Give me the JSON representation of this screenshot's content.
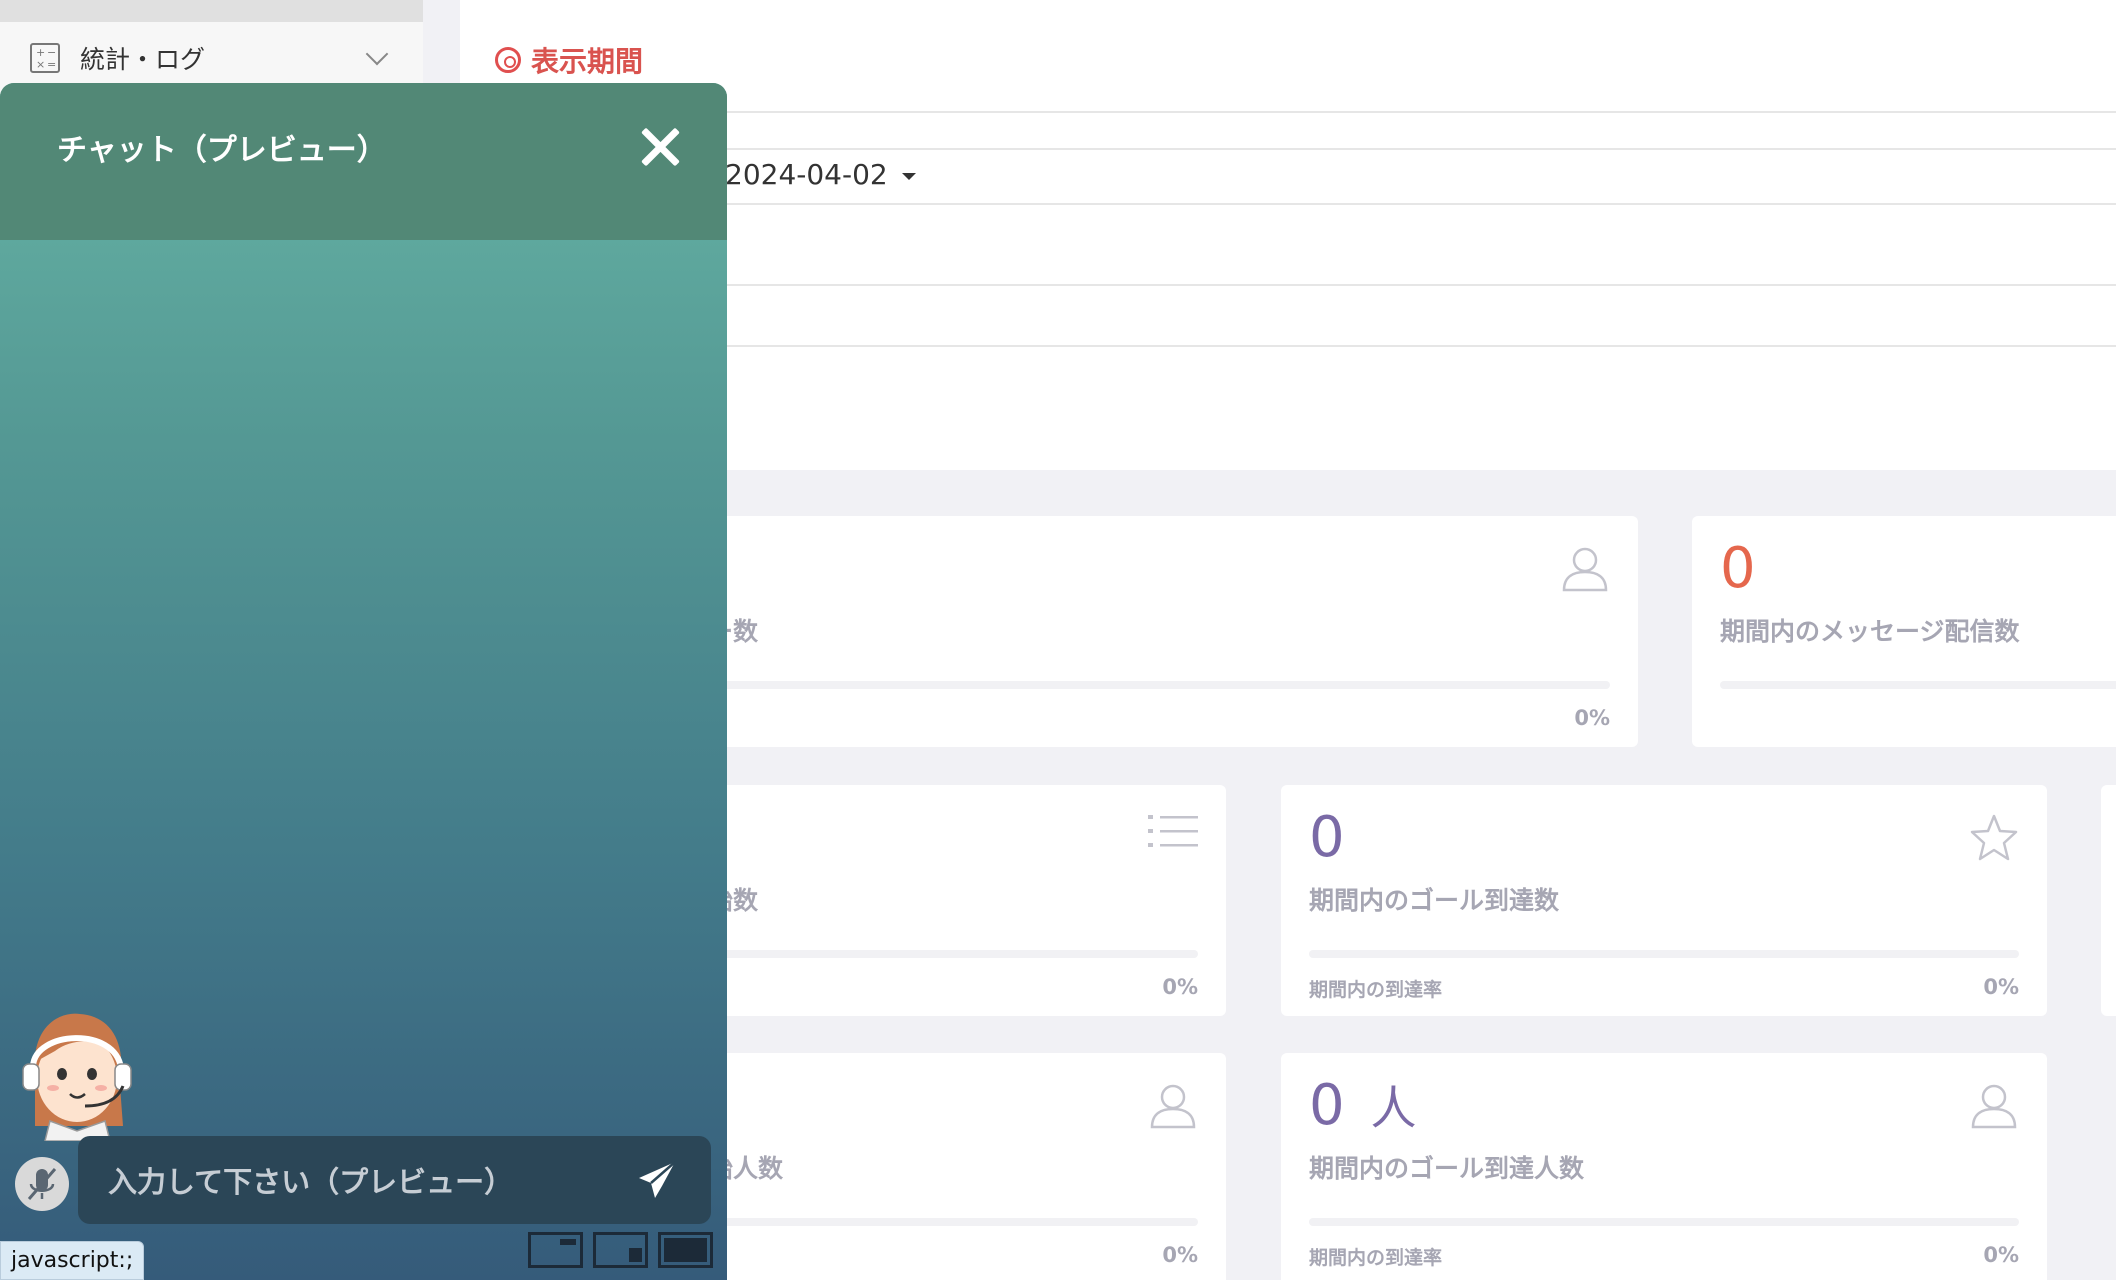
{
  "sidebar": {
    "stats_item": {
      "label": "統計・ログ",
      "icon": "calculator-icon"
    }
  },
  "period": {
    "title": "表示期間",
    "date_value": "2024-04-02"
  },
  "cards": {
    "users": {
      "label_partial": "ー数",
      "percent": "0%",
      "icon": "user-icon"
    },
    "messages": {
      "value": "0",
      "label": "期間内のメッセージ配信数"
    },
    "sessions": {
      "label_partial": "始数",
      "percent": "0%",
      "icon": "list-icon"
    },
    "goals": {
      "value": "0",
      "label": "期間内のゴール到達数",
      "sub_label": "期間内の到達率",
      "percent": "0%",
      "icon": "star-icon"
    },
    "session_users": {
      "label_partial": "始人数",
      "percent": "0%",
      "icon": "user-icon"
    },
    "goal_users": {
      "value": "0",
      "unit": "人",
      "label": "期間内のゴール到達人数",
      "sub_label": "期間内の到達率",
      "percent": "0%",
      "icon": "user-icon"
    }
  },
  "colors": {
    "accent_red": "#d9534f",
    "value_orange": "#e5674d",
    "value_purple": "#7a6aa6",
    "chat_header": "#528876"
  },
  "chat": {
    "title": "チャット（プレビュー）",
    "input_placeholder": "入力して下さい（プレビュー）"
  },
  "status_bar": {
    "link_text": "javascript:;"
  }
}
